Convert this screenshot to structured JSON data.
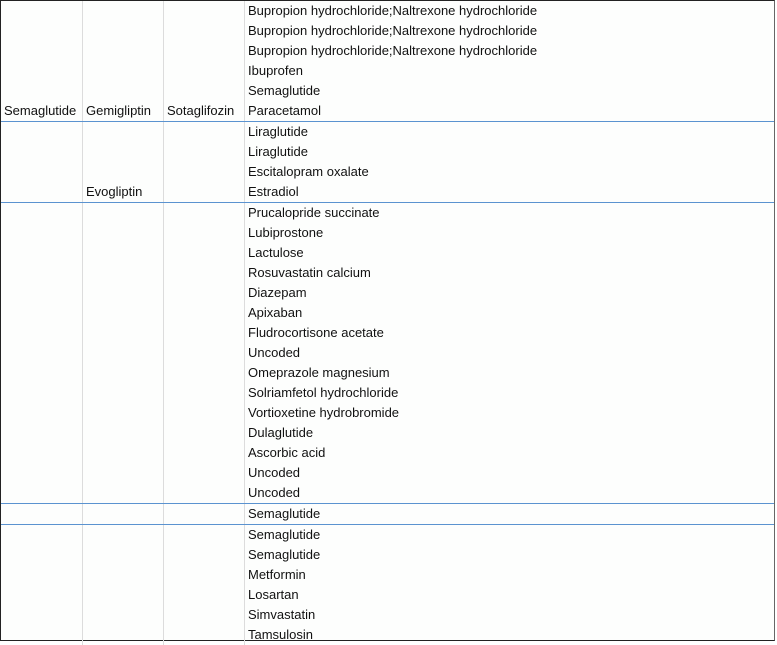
{
  "groups": [
    {
      "col1": "Semaglutide",
      "col2": "Gemigliptin",
      "col3": "Sotaglifozin",
      "items": [
        "Bupropion hydrochloride;Naltrexone hydrochloride",
        "Bupropion hydrochloride;Naltrexone hydrochloride",
        "Bupropion hydrochloride;Naltrexone hydrochloride",
        "Ibuprofen",
        "Semaglutide",
        "Paracetamol"
      ]
    },
    {
      "col1": "",
      "col2": "Evogliptin",
      "col3": "",
      "items": [
        "Liraglutide",
        "Liraglutide",
        "Escitalopram oxalate",
        "Estradiol"
      ]
    },
    {
      "col1": "",
      "col2": "",
      "col3": "",
      "items": [
        "Prucalopride succinate",
        "Lubiprostone",
        "Lactulose",
        "Rosuvastatin calcium",
        "Diazepam",
        "Apixaban",
        "Fludrocortisone acetate",
        "Uncoded",
        "Omeprazole magnesium",
        "Solriamfetol hydrochloride",
        "Vortioxetine hydrobromide",
        "Dulaglutide",
        "Ascorbic acid",
        "Uncoded",
        "Uncoded"
      ]
    },
    {
      "col1": "",
      "col2": "",
      "col3": "",
      "items": [
        "Semaglutide"
      ]
    },
    {
      "col1": "",
      "col2": "",
      "col3": "",
      "items": [
        "Semaglutide",
        "Semaglutide",
        "Metformin",
        "Losartan",
        "Simvastatin",
        "Tamsulosin"
      ]
    }
  ]
}
